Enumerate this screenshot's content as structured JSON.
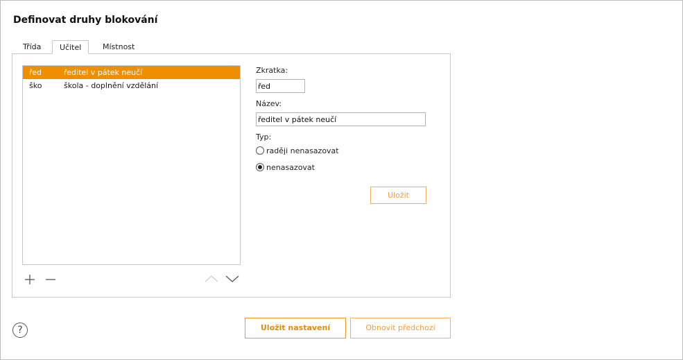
{
  "dialog": {
    "title": "Definovat druhy blokování"
  },
  "tabs": [
    {
      "label": "Třída"
    },
    {
      "label": "Učitel"
    },
    {
      "label": "Místnost"
    }
  ],
  "list": {
    "items": [
      {
        "abbr": "řed",
        "name": "ředitel v pátek neučí"
      },
      {
        "abbr": "ško",
        "name": "škola - doplnění vzdělání"
      }
    ],
    "selected_index": 0
  },
  "form": {
    "abbr_label": "Zkratka:",
    "abbr_value": "řed",
    "name_label": "Název:",
    "name_value": "ředitel v pátek neučí",
    "type_label": "Typ:",
    "type_options": [
      "raději nenasazovat",
      "nenasazovat"
    ],
    "type_selected": "nenasazovat",
    "save_label": "Uložit"
  },
  "footer": {
    "save_settings_label": "Uložit nastavení",
    "restore_label": "Obnovit předchozí",
    "help_glyph": "?"
  },
  "colors": {
    "accent": "#ef8f00",
    "button_border": "#ef9a1e",
    "button_text": "#e08a10"
  },
  "icons": [
    "plus-icon",
    "minus-icon",
    "chevron-up-icon",
    "chevron-down-icon",
    "help-icon"
  ]
}
